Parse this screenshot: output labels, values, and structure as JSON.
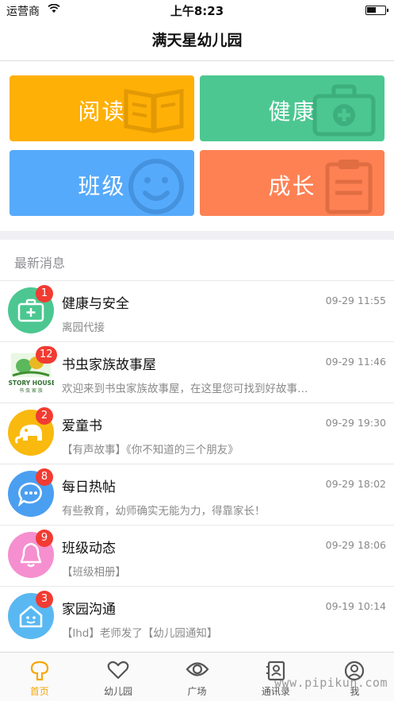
{
  "status_bar": {
    "carrier": "运营商",
    "time": "上午8:23"
  },
  "header": {
    "title": "满天星幼儿园"
  },
  "tiles": [
    {
      "label": "阅读",
      "color": "#ffb006",
      "icon": "book-icon"
    },
    {
      "label": "健康",
      "color": "#4cc791",
      "icon": "first-aid-kit-icon"
    },
    {
      "label": "班级",
      "color": "#56aafb",
      "icon": "smiley-face-icon"
    },
    {
      "label": "成长",
      "color": "#fe8154",
      "icon": "clipboard-icon"
    }
  ],
  "section": {
    "title": "最新消息"
  },
  "messages": [
    {
      "title": "健康与安全",
      "time": "09-29 11:55",
      "preview": "离园代接",
      "badge": "1",
      "avatar_color": "#4cc791",
      "icon": "first-aid-kit-icon"
    },
    {
      "title": "书虫家族故事屋",
      "time": "09-29 11:46",
      "preview": "欢迎来到书虫家族故事屋，在这里您可找到好故事…",
      "badge": "12",
      "avatar_color": "#ffffff",
      "icon": "story-house-logo",
      "logo_text": "iSTORY HOUSE",
      "logo_subtext": "书 虫 家 族"
    },
    {
      "title": "爱童书",
      "time": "09-29 19:30",
      "preview": "【有声故事】《你不知道的三个朋友》",
      "badge": "2",
      "avatar_color": "#f9b90f",
      "icon": "elephant-icon"
    },
    {
      "title": "每日热帖",
      "time": "09-29 18:02",
      "preview": "有些教育，幼师确实无能为力，得靠家长！",
      "badge": "8",
      "avatar_color": "#4b9ff0",
      "icon": "chat-bubble-icon"
    },
    {
      "title": "班级动态",
      "time": "09-29 18:06",
      "preview": "【班级相册】",
      "badge": "9",
      "avatar_color": "#f58fcf",
      "icon": "bell-icon"
    },
    {
      "title": "家园沟通",
      "time": "09-19 10:14",
      "preview": "【lhd】老师发了【幼儿园通知】",
      "badge": "3",
      "avatar_color": "#59b8f2",
      "icon": "house-icon"
    }
  ],
  "tabs": [
    {
      "label": "首页",
      "icon": "home-tree-icon",
      "active": true
    },
    {
      "label": "幼儿园",
      "icon": "heart-icon",
      "active": false
    },
    {
      "label": "广场",
      "icon": "eye-icon",
      "active": false
    },
    {
      "label": "通讯录",
      "icon": "contacts-icon",
      "active": false
    },
    {
      "label": "我",
      "icon": "user-icon",
      "active": false
    }
  ],
  "watermark": "www.pipikun.com"
}
